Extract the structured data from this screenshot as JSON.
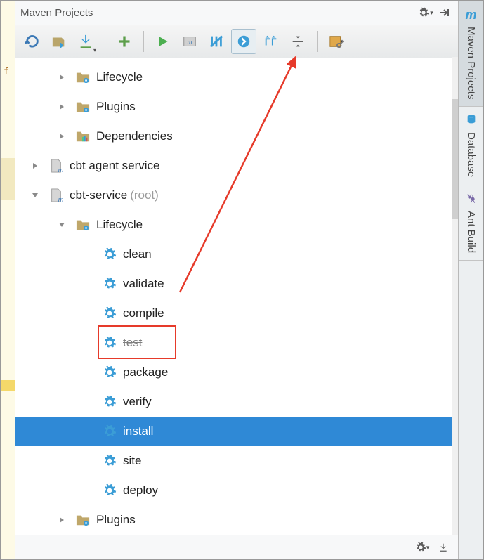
{
  "header": {
    "title": "Maven Projects"
  },
  "sidebar": {
    "tabs": [
      {
        "name": "maven",
        "label": "Maven Projects",
        "active": true
      },
      {
        "name": "database",
        "label": "Database",
        "active": false
      },
      {
        "name": "ant",
        "label": "Ant Build",
        "active": false
      }
    ]
  },
  "tree": [
    {
      "indent": 1,
      "arrow": "right",
      "icon": "folder-gear",
      "label": "Lifecycle"
    },
    {
      "indent": 1,
      "arrow": "right",
      "icon": "folder-gear",
      "label": "Plugins"
    },
    {
      "indent": 1,
      "arrow": "right",
      "icon": "folder-deps",
      "label": "Dependencies"
    },
    {
      "indent": 0,
      "arrow": "right",
      "icon": "file-m",
      "label": "cbt agent service"
    },
    {
      "indent": 0,
      "arrow": "down",
      "icon": "file-m",
      "label": "cbt-service",
      "suffix": "(root)"
    },
    {
      "indent": 1,
      "arrow": "down",
      "icon": "folder-gear",
      "label": "Lifecycle"
    },
    {
      "indent": 2,
      "arrow": "",
      "icon": "gear",
      "label": "clean"
    },
    {
      "indent": 2,
      "arrow": "",
      "icon": "gear",
      "label": "validate"
    },
    {
      "indent": 2,
      "arrow": "",
      "icon": "gear",
      "label": "compile"
    },
    {
      "indent": 2,
      "arrow": "",
      "icon": "gear",
      "label": "test",
      "strike": true,
      "redbox": true
    },
    {
      "indent": 2,
      "arrow": "",
      "icon": "gear",
      "label": "package"
    },
    {
      "indent": 2,
      "arrow": "",
      "icon": "gear",
      "label": "verify"
    },
    {
      "indent": 2,
      "arrow": "",
      "icon": "gear",
      "label": "install",
      "selected": true
    },
    {
      "indent": 2,
      "arrow": "",
      "icon": "gear",
      "label": "site"
    },
    {
      "indent": 2,
      "arrow": "",
      "icon": "gear",
      "label": "deploy"
    },
    {
      "indent": 1,
      "arrow": "right",
      "icon": "folder-gear",
      "label": "Plugins"
    }
  ]
}
